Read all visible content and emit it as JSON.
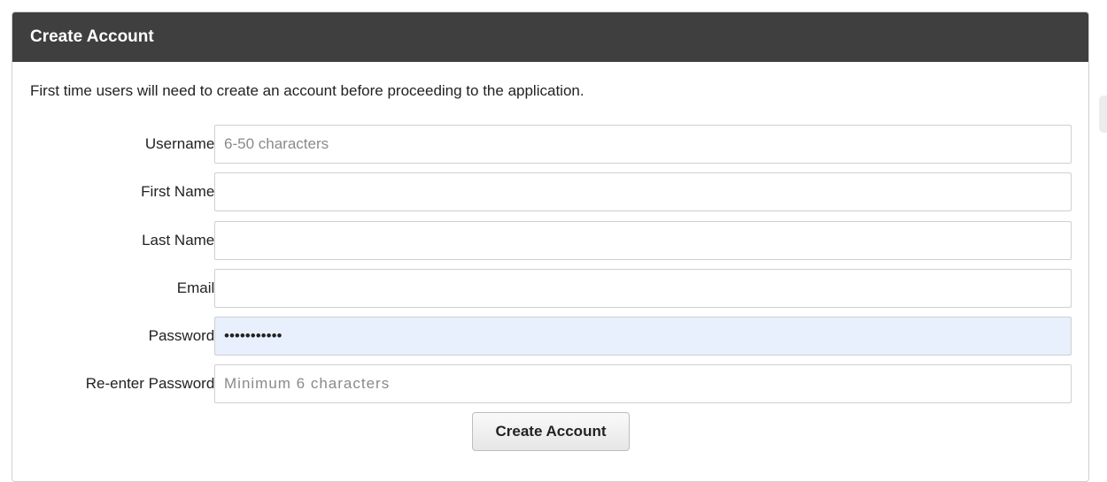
{
  "panel": {
    "title": "Create Account",
    "intro": "First time users will need to create an account before proceeding to the application."
  },
  "form": {
    "fields": [
      {
        "label": "Username:",
        "placeholder": "6-50 characters",
        "value": ""
      },
      {
        "label": "First Name:",
        "placeholder": "",
        "value": ""
      },
      {
        "label": "Last Name:",
        "placeholder": "",
        "value": ""
      },
      {
        "label": "Email:",
        "placeholder": "",
        "value": ""
      },
      {
        "label": "Password:",
        "placeholder": "",
        "value": "•••••••••••"
      },
      {
        "label": "Re-enter Password:",
        "placeholder": "Minimum 6 characters",
        "value": ""
      }
    ],
    "submit_label": "Create Account"
  },
  "colors": {
    "header_bg": "#3f3f3f",
    "autofill_bg": "#e8f0fe"
  }
}
